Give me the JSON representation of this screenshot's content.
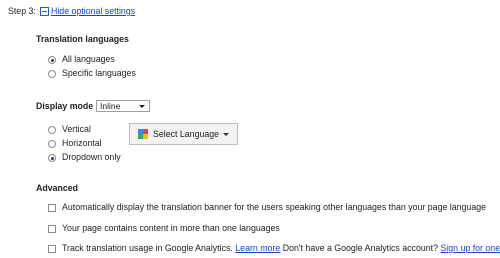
{
  "step": {
    "label": "Step 3:",
    "hide_link": "Hide optional settings"
  },
  "translation_languages": {
    "title": "Translation languages",
    "options": [
      {
        "label": "All languages",
        "checked": true
      },
      {
        "label": "Specific languages",
        "checked": false
      }
    ]
  },
  "display_mode": {
    "title": "Display mode",
    "select_value": "Inline",
    "options": [
      {
        "label": "Vertical",
        "checked": false
      },
      {
        "label": "Horizontal",
        "checked": false
      },
      {
        "label": "Dropdown only",
        "checked": true
      }
    ],
    "preview_label": "Select Language"
  },
  "advanced": {
    "title": "Advanced",
    "auto_banner": "Automatically display the translation banner for the users speaking other languages than your page language",
    "multi_lang": "Your page contains content in more than one languages",
    "analytics_text": "Track translation usage in Google Analytics.",
    "learn_more": "Learn more",
    "no_account": "Don't have a Google Analytics account?",
    "sign_up": "Sign up for one now"
  }
}
